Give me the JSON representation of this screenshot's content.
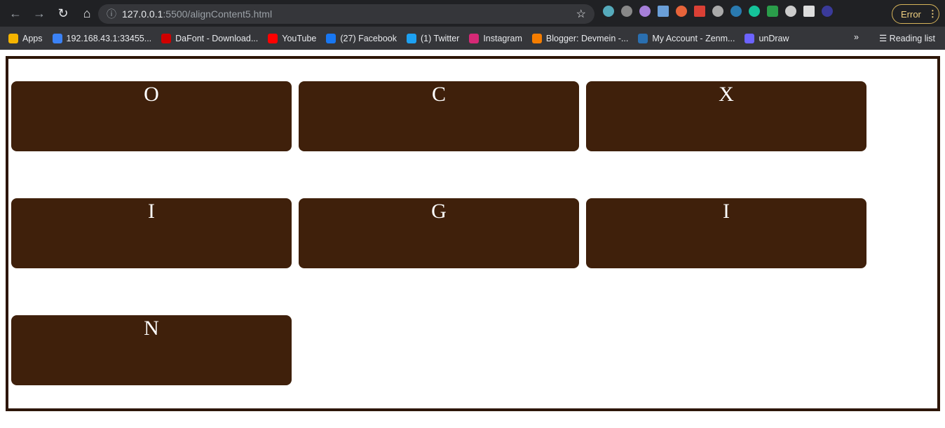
{
  "browser": {
    "url_host": "127.0.0.1",
    "url_rest": ":5500/alignContent5.html",
    "profile_button": "Error",
    "bookmarks": [
      {
        "label": "Apps",
        "color": "#f4b400"
      },
      {
        "label": "192.168.43.1:33455...",
        "color": "#3b82f6"
      },
      {
        "label": "DaFont - Download...",
        "color": "#d00000"
      },
      {
        "label": "YouTube",
        "color": "#ff0000"
      },
      {
        "label": "(27) Facebook",
        "color": "#1877f2"
      },
      {
        "label": "(1) Twitter",
        "color": "#1da1f2"
      },
      {
        "label": "Instagram",
        "color": "#d62976"
      },
      {
        "label": "Blogger: Devmein -...",
        "color": "#f57d00"
      },
      {
        "label": "My Account - Zenm...",
        "color": "#2a6fb0"
      },
      {
        "label": "unDraw",
        "color": "#6c63ff"
      }
    ],
    "reading_list": "Reading list"
  },
  "items": [
    "O",
    "C",
    "X",
    "I",
    "G",
    "I",
    "N"
  ],
  "colors": {
    "box": "#3f200b",
    "border": "#2d1608"
  }
}
